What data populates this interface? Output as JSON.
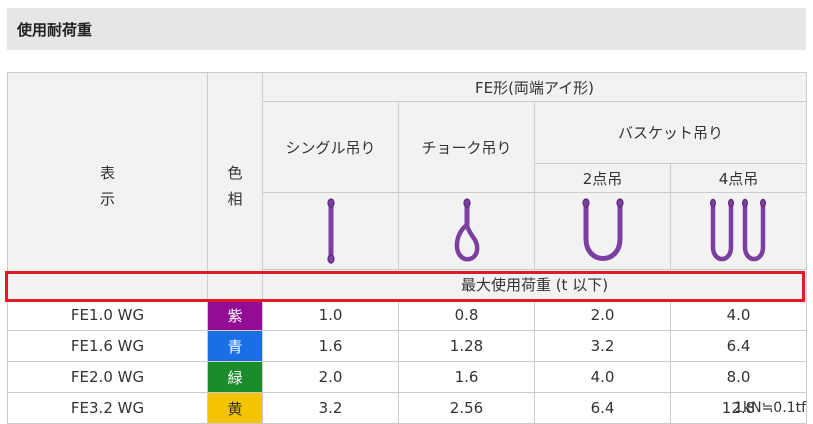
{
  "title": "使用耐荷重",
  "table": {
    "col_display": [
      "表",
      "示"
    ],
    "col_color": [
      "色",
      "相"
    ],
    "fe_type": "FE形(両端アイ形)",
    "single": "シングル吊り",
    "choke": "チョーク吊り",
    "basket": "バスケット吊り",
    "two_point": "2点吊",
    "four_point": "4点吊",
    "max_load": "最大使用荷重 (t 以下)",
    "icons": [
      "single-hang-sling-icon",
      "choke-hang-sling-icon",
      "basket-two-point-sling-icon",
      "basket-four-point-sling-icon"
    ],
    "sling_color": "#7b3fa0",
    "rows": [
      {
        "model": "FE1.0 WG",
        "color_name": "紫",
        "color": "#920c94",
        "single": "1.0",
        "choke": "0.8",
        "two": "2.0",
        "four": "4.0"
      },
      {
        "model": "FE1.6 WG",
        "color_name": "青",
        "color": "#1a6fe5",
        "single": "1.6",
        "choke": "1.28",
        "two": "3.2",
        "four": "6.4"
      },
      {
        "model": "FE2.0 WG",
        "color_name": "緑",
        "color": "#1a8c2c",
        "single": "2.0",
        "choke": "1.6",
        "two": "4.0",
        "four": "8.0"
      },
      {
        "model": "FE3.2 WG",
        "color_name": "黄",
        "color": "#f5c400",
        "single": "3.2",
        "choke": "2.56",
        "two": "6.4",
        "four": "12.8"
      }
    ]
  },
  "note": "1kN≒0.1tf"
}
